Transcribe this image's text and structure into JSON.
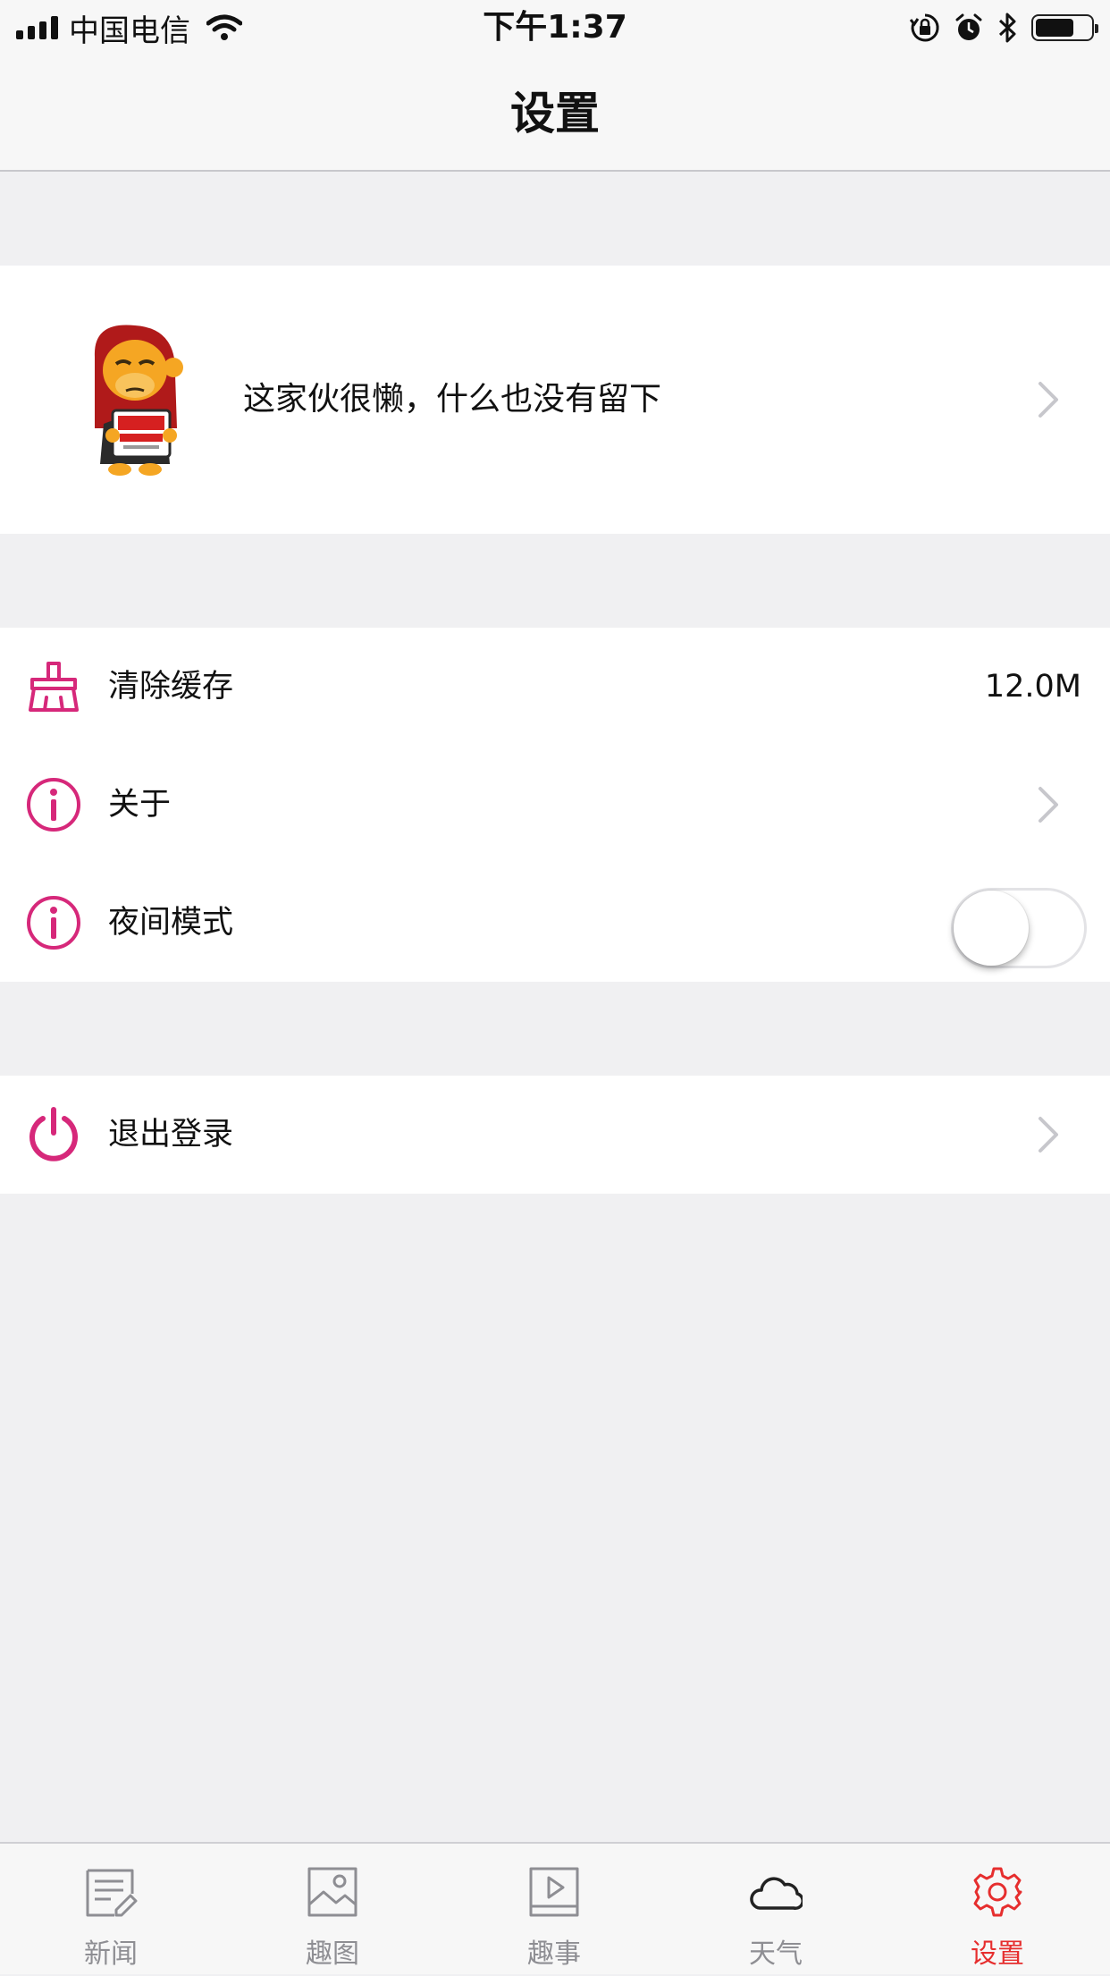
{
  "status_bar": {
    "carrier": "中国电信",
    "time": "下午1:37",
    "battery_level": 0.7
  },
  "nav": {
    "title": "设置"
  },
  "profile": {
    "signature": "这家伙很懒，什么也没有留下"
  },
  "settings": {
    "clear_cache": {
      "label": "清除缓存",
      "value": "12.0M",
      "icon": "broom-icon"
    },
    "about": {
      "label": "关于",
      "icon": "info-icon"
    },
    "night_mode": {
      "label": "夜间模式",
      "icon": "info-icon",
      "enabled": false
    },
    "logout": {
      "label": "退出登录",
      "icon": "power-icon"
    }
  },
  "tabs": [
    {
      "label": "新闻",
      "icon": "news-icon",
      "active": false
    },
    {
      "label": "趣图",
      "icon": "image-icon",
      "active": false
    },
    {
      "label": "趣事",
      "icon": "video-icon",
      "active": false
    },
    {
      "label": "天气",
      "icon": "cloud-icon",
      "active": false
    },
    {
      "label": "设置",
      "icon": "gear-icon",
      "active": true
    }
  ],
  "colors": {
    "accent": "#d6287a",
    "tab_active": "#e62e2e",
    "tab_inactive": "#8e8e93",
    "background": "#f0f0f2"
  }
}
